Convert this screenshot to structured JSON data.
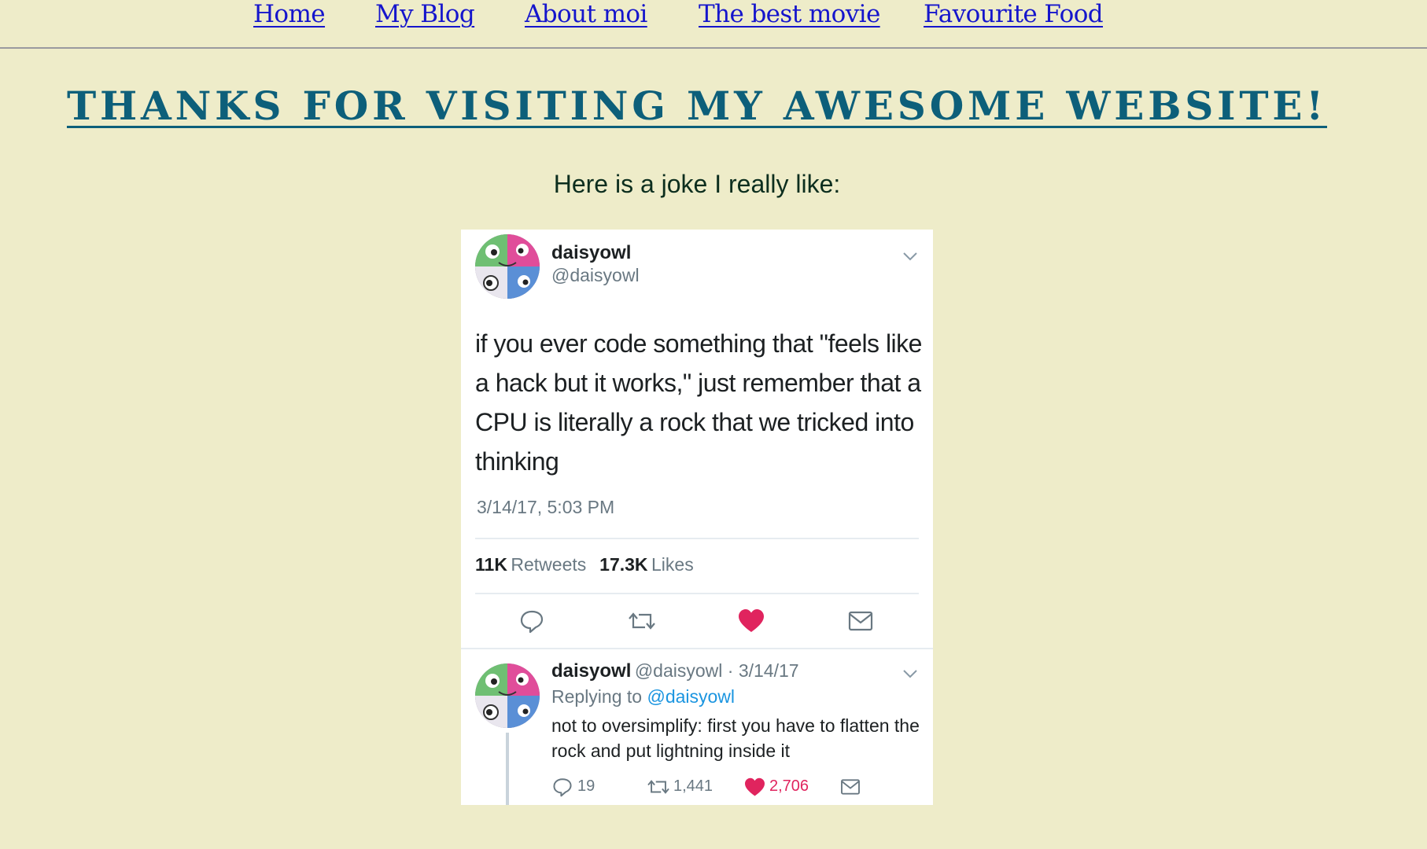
{
  "nav": {
    "items": [
      {
        "label": "Home"
      },
      {
        "label": "My Blog"
      },
      {
        "label": "About moi"
      },
      {
        "label": "The best movie"
      },
      {
        "label": "Favourite Food"
      }
    ]
  },
  "page": {
    "title": "THANKS FOR VISITING MY AWESOME WEBSITE!",
    "intro": "Here is a joke I really like:"
  },
  "tweet": {
    "name": "daisyowl",
    "handle": "@daisyowl",
    "text": "if you ever code something that \"feels like a hack but it works,\" just remember that a CPU is literally a rock that we tricked into thinking",
    "timestamp": "3/14/17, 5:03 PM",
    "retweets_count": "11K",
    "retweets_label": "Retweets",
    "likes_count": "17.3K",
    "likes_label": "Likes",
    "icons": [
      "reply-icon",
      "retweet-icon",
      "heart-icon",
      "mail-icon"
    ],
    "liked_color": "#e0245e"
  },
  "reply": {
    "name": "daisyowl",
    "handle_date": "@daisyowl · 3/14/17",
    "replying_prefix": "Replying to",
    "replying_handle": "@daisyowl",
    "text": "not to oversimplify: first you have to flatten the rock and put lightning inside it",
    "reply_count": "19",
    "retweet_count": "1,441",
    "like_count": "2,706"
  },
  "colors": {
    "background": "#EEECC9",
    "nav_link": "#1515CC",
    "title": "#0D5F7A",
    "intro": "#0C2E1E"
  }
}
